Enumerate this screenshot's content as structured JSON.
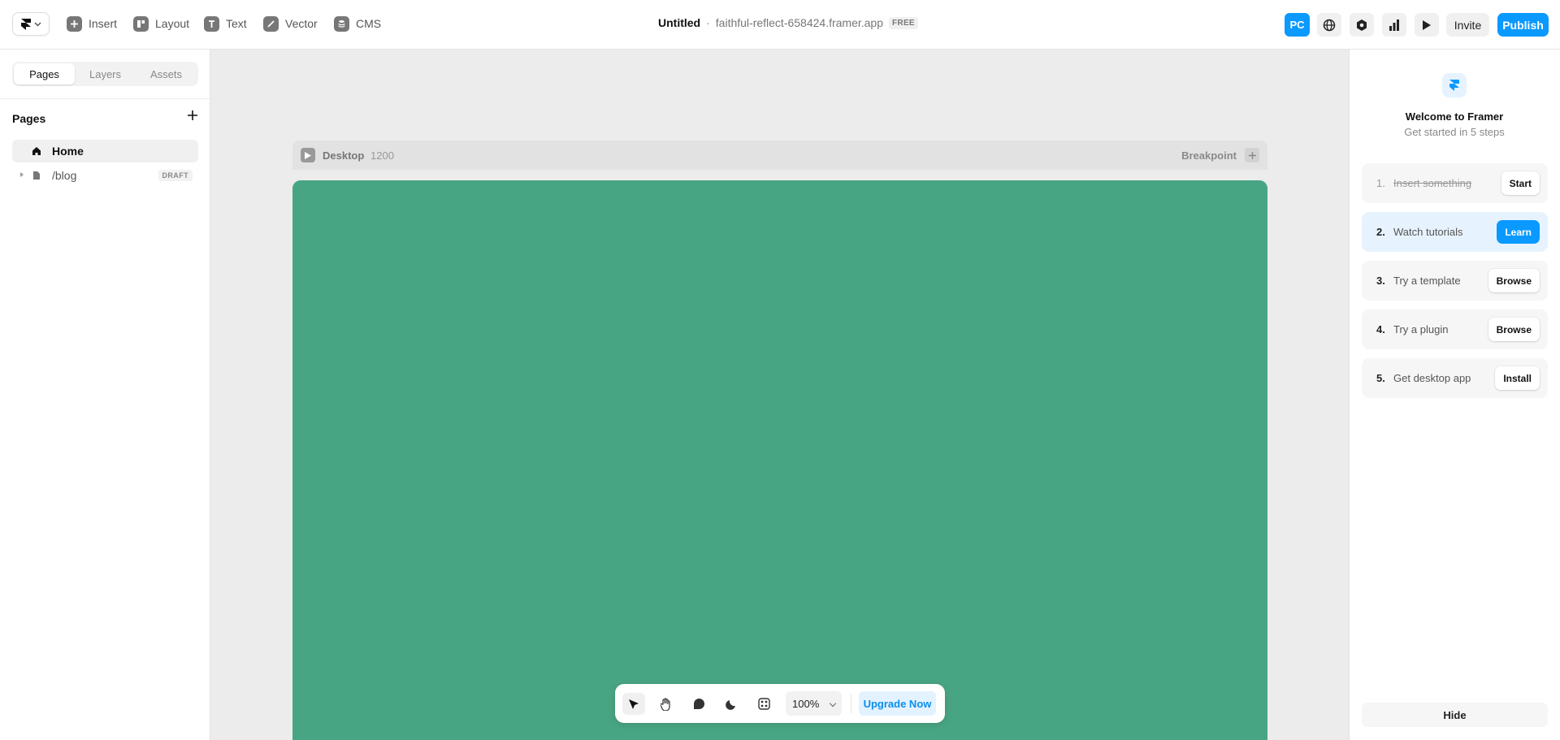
{
  "toolbar": {
    "items": [
      {
        "label": "Insert",
        "icon": "plus-square-icon"
      },
      {
        "label": "Layout",
        "icon": "layout-icon"
      },
      {
        "label": "Text",
        "icon": "text-icon"
      },
      {
        "label": "Vector",
        "icon": "pen-icon"
      },
      {
        "label": "CMS",
        "icon": "database-icon"
      }
    ]
  },
  "header": {
    "title": "Untitled",
    "separator": "·",
    "url": "faithful-reflect-658424.framer.app",
    "plan_badge": "FREE",
    "user_initials": "PC",
    "invite_label": "Invite",
    "publish_label": "Publish"
  },
  "left_panel": {
    "tabs": [
      "Pages",
      "Layers",
      "Assets"
    ],
    "active_tab": "Pages",
    "section_title": "Pages",
    "pages": [
      {
        "label": "Home",
        "icon": "home-icon",
        "selected": true
      },
      {
        "label": "/blog",
        "icon": "page-icon",
        "badge": "DRAFT"
      }
    ]
  },
  "canvas": {
    "frame_name": "Desktop",
    "frame_width": "1200",
    "breakpoint_label": "Breakpoint",
    "frame_color": "#48a583"
  },
  "bottom_toolbar": {
    "zoom": "100%",
    "upgrade_label": "Upgrade Now"
  },
  "welcome": {
    "title": "Welcome to Framer",
    "subtitle": "Get started in 5 steps",
    "steps": [
      {
        "num": "1.",
        "label": "Insert something",
        "button": "Start",
        "done": true
      },
      {
        "num": "2.",
        "label": "Watch tutorials",
        "button": "Learn",
        "highlight": true
      },
      {
        "num": "3.",
        "label": "Try a template",
        "button": "Browse"
      },
      {
        "num": "4.",
        "label": "Try a plugin",
        "button": "Browse"
      },
      {
        "num": "5.",
        "label": "Get desktop app",
        "button": "Install"
      }
    ],
    "hide_label": "Hide"
  },
  "colors": {
    "accent": "#0a99ff",
    "canvas_bg": "#ececec"
  }
}
